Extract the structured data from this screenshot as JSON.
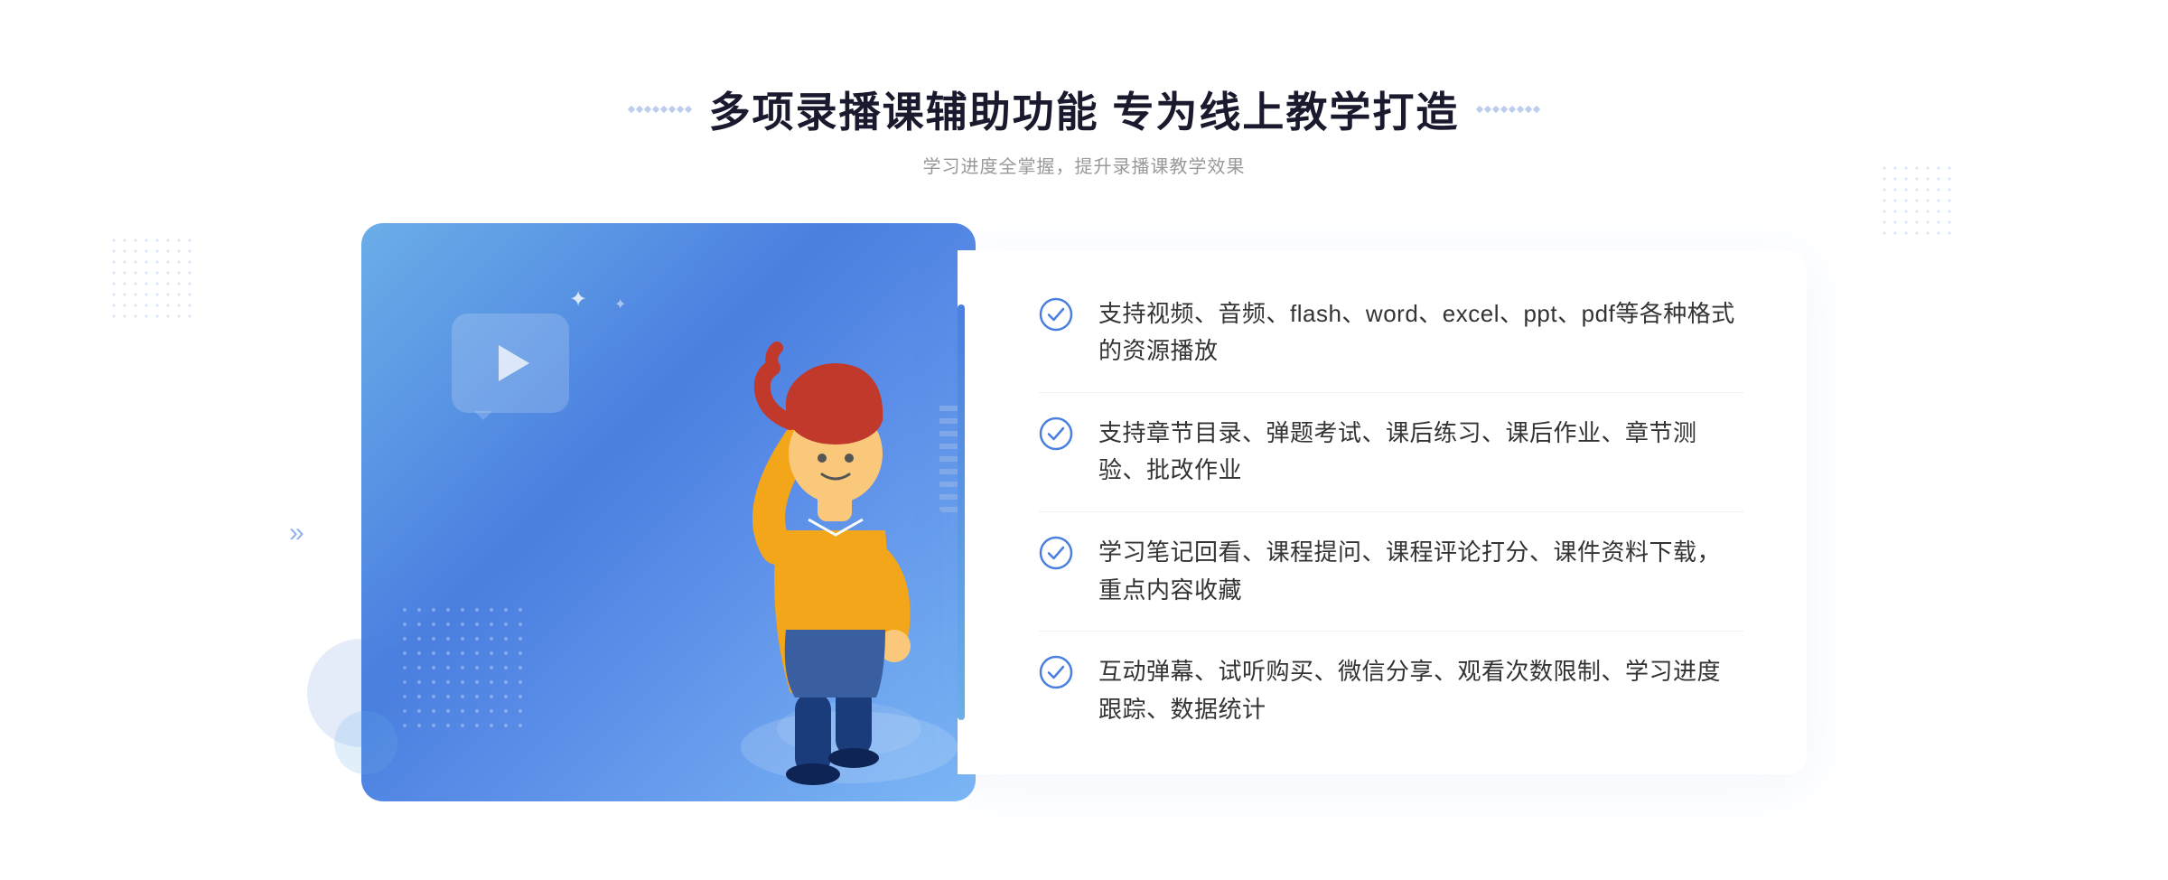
{
  "header": {
    "title": "多项录播课辅助功能 专为线上教学打造",
    "subtitle": "学习进度全掌握，提升录播课教学效果",
    "deco_dots_count": 8
  },
  "features": [
    {
      "id": 1,
      "text": "支持视频、音频、flash、word、excel、ppt、pdf等各种格式的资源播放"
    },
    {
      "id": 2,
      "text": "支持章节目录、弹题考试、课后练习、课后作业、章节测验、批改作业"
    },
    {
      "id": 3,
      "text": "学习笔记回看、课程提问、课程评论打分、课件资料下载，重点内容收藏"
    },
    {
      "id": 4,
      "text": "互动弹幕、试听购买、微信分享、观看次数限制、学习进度跟踪、数据统计"
    }
  ],
  "colors": {
    "primary_blue": "#4a7fe0",
    "light_blue": "#6baee8",
    "title_color": "#1a1a2e",
    "text_color": "#333333",
    "subtitle_color": "#999999",
    "divider_color": "#f0f0f0"
  },
  "icons": {
    "check": "check-circle",
    "play": "play-triangle",
    "chevron_left": "«",
    "chevron_right": "»"
  }
}
